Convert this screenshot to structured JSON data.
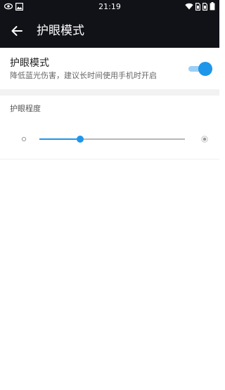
{
  "status_bar": {
    "time": "21:19",
    "left_icons": [
      "eye-icon",
      "image-icon"
    ],
    "right_icons": [
      "wifi-icon",
      "sim-1-icon",
      "sim-2-icon",
      "battery-icon"
    ]
  },
  "app_bar": {
    "back_icon": "arrow-left-icon",
    "title": "护眼模式"
  },
  "eye_mode": {
    "title": "护眼模式",
    "description": "降低蓝光伤害，建议长时间使用手机时开启",
    "enabled": true
  },
  "intensity": {
    "label": "护眼程度",
    "level": 0.28,
    "min_icon": "sun-small-icon",
    "max_icon": "sun-large-icon"
  },
  "colors": {
    "accent": "#1e96ea",
    "accent_light": "#9ccff6",
    "header_bg": "#111218",
    "divider": "#f2f2f2"
  }
}
